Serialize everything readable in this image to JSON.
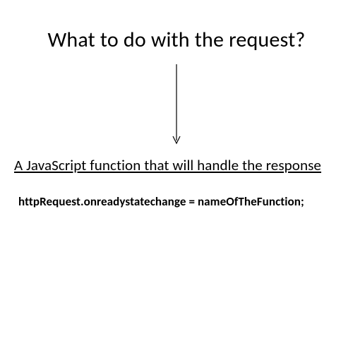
{
  "title": "What to do with the request?",
  "subtitle": "A JavaScript function that will handle the response",
  "code": "httpRequest.onreadystatechange = nameOfTheFunction;",
  "arrow": {
    "height": 120,
    "stroke": "#000000"
  }
}
